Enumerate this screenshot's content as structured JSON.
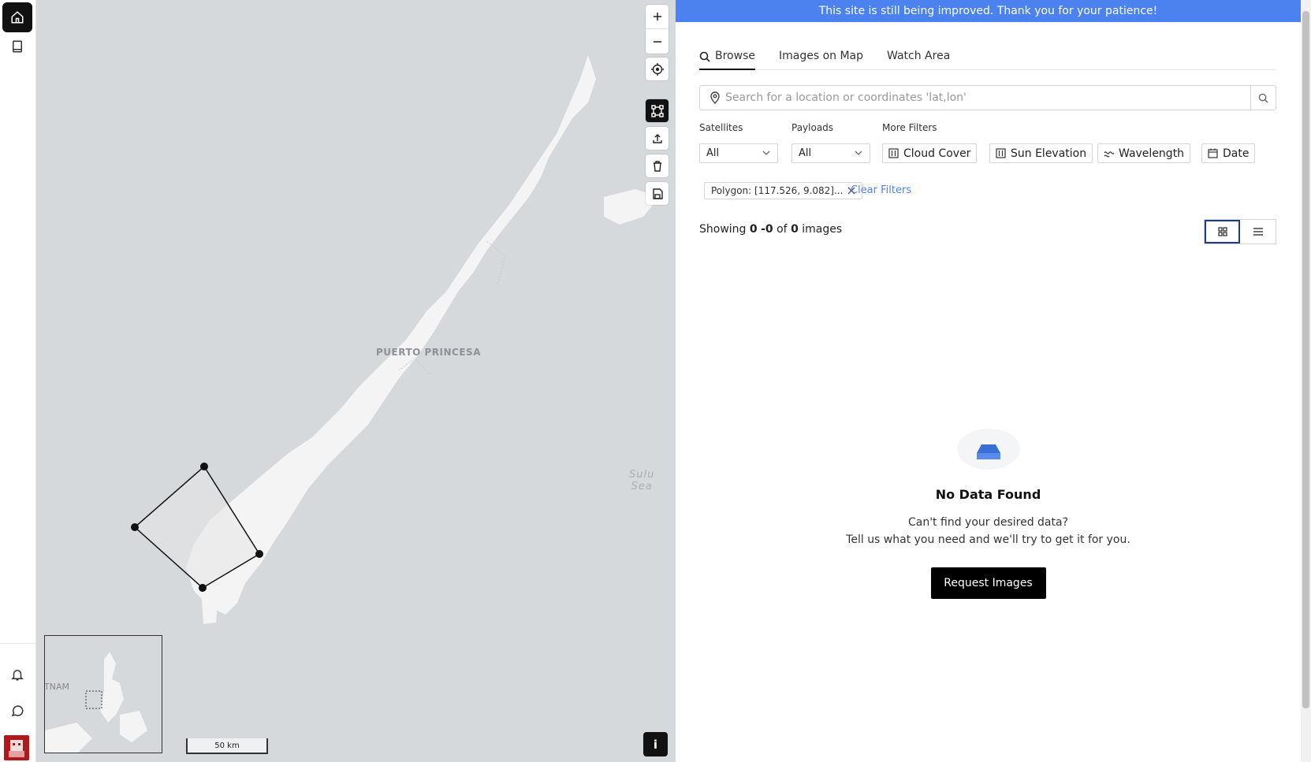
{
  "rail": {
    "icons": [
      "home-icon",
      "book-icon",
      "bell-icon",
      "chat-icon"
    ]
  },
  "map": {
    "city_label": "PUERTO PRINCESA",
    "sea_label_1": "Sulu",
    "sea_label_2": "Sea",
    "minimap_label": "TNAM",
    "scale_label": "50 km",
    "zoom_in": "+",
    "zoom_out": "−",
    "info_label": "i"
  },
  "panel": {
    "banner": "This site is still being improved. Thank you for your patience!",
    "tabs": [
      "Browse",
      "Images on Map",
      "Watch Area"
    ],
    "search_placeholder": "Search for a location or coordinates 'lat,lon'",
    "filters": {
      "satellites_label": "Satellites",
      "satellites_value": "All",
      "payloads_label": "Payloads",
      "payloads_value": "All",
      "more_label": "More Filters",
      "buttons": [
        "Cloud Cover",
        "Sun Elevation",
        "Wavelength",
        "Date"
      ]
    },
    "chip": "Polygon: [117.526, 9.082]...",
    "clear_filters": "Clear Filters",
    "showing": {
      "prefix": "Showing",
      "from": "0",
      "to": "-0",
      "of_word": "of",
      "total": "0",
      "suffix": "images"
    },
    "empty": {
      "title": "No Data Found",
      "line1": "Can't find your desired data?",
      "line2": "Tell us what you need and we'll try to get it for you.",
      "button": "Request Images"
    }
  },
  "colors": {
    "banner": "#4b82ef",
    "link": "#4b82ef",
    "avatar": "#b3161b"
  }
}
